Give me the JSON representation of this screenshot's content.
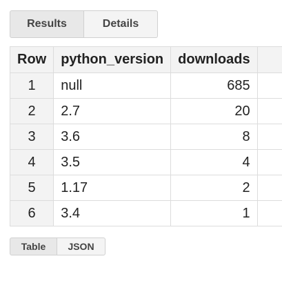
{
  "tabs": {
    "results_label": "Results",
    "details_label": "Details"
  },
  "table": {
    "headers": {
      "row": "Row",
      "python_version": "python_version",
      "downloads": "downloads"
    },
    "rows": [
      {
        "row": "1",
        "python_version": "null",
        "downloads": "685"
      },
      {
        "row": "2",
        "python_version": "2.7",
        "downloads": "20"
      },
      {
        "row": "3",
        "python_version": "3.6",
        "downloads": "8"
      },
      {
        "row": "4",
        "python_version": "3.5",
        "downloads": "4"
      },
      {
        "row": "5",
        "python_version": "1.17",
        "downloads": "2"
      },
      {
        "row": "6",
        "python_version": "3.4",
        "downloads": "1"
      }
    ]
  },
  "view_toggle": {
    "table_label": "Table",
    "json_label": "JSON"
  }
}
